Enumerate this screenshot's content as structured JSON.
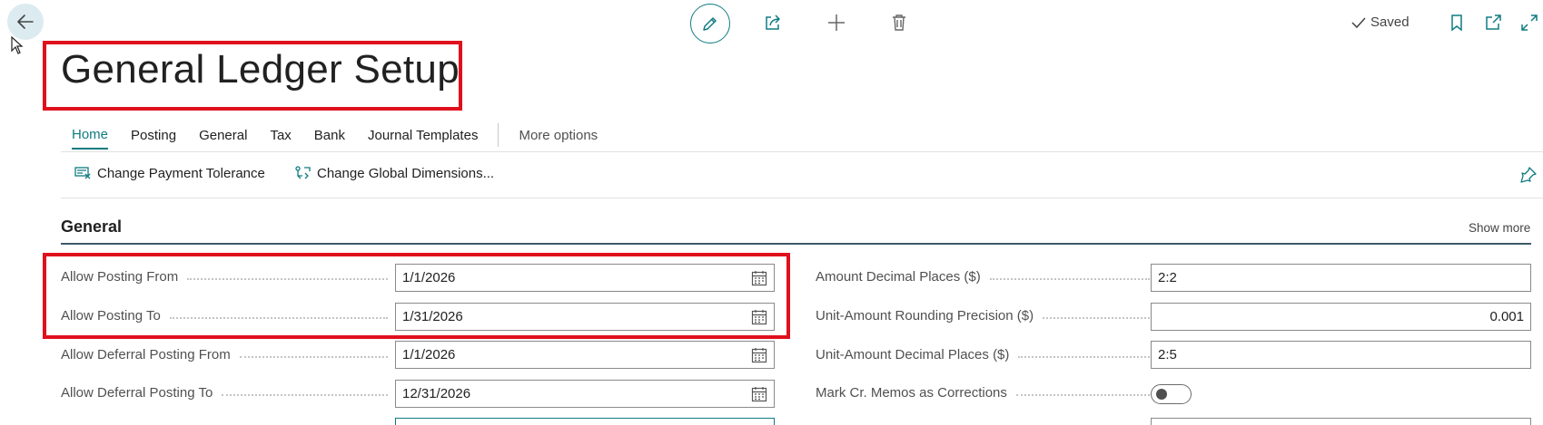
{
  "page": {
    "title": "General Ledger Setup",
    "saved_label": "Saved"
  },
  "tabs": [
    {
      "label": "Home",
      "active": true
    },
    {
      "label": "Posting"
    },
    {
      "label": "General"
    },
    {
      "label": "Tax"
    },
    {
      "label": "Bank"
    },
    {
      "label": "Journal Templates"
    }
  ],
  "more_options_label": "More options",
  "actions": {
    "change_payment_tolerance": "Change Payment Tolerance",
    "change_global_dimensions": "Change Global Dimensions..."
  },
  "section": {
    "title": "General",
    "show_more": "Show more"
  },
  "fields_left": [
    {
      "label": "Allow Posting From",
      "value": "1/1/2026"
    },
    {
      "label": "Allow Posting To",
      "value": "1/31/2026"
    },
    {
      "label": "Allow Deferral Posting From",
      "value": "1/1/2026"
    },
    {
      "label": "Allow Deferral Posting To",
      "value": "12/31/2026"
    }
  ],
  "fields_right": [
    {
      "label": "Amount Decimal Places ($)",
      "value": "2:2"
    },
    {
      "label": "Unit-Amount Rounding Precision ($)",
      "value": "0.001"
    },
    {
      "label": "Unit-Amount Decimal Places ($)",
      "value": "2:5"
    },
    {
      "label": "Mark Cr. Memos as Corrections",
      "value": "off"
    }
  ],
  "colors": {
    "accent": "#0f7b82",
    "highlight": "#e0101d"
  }
}
